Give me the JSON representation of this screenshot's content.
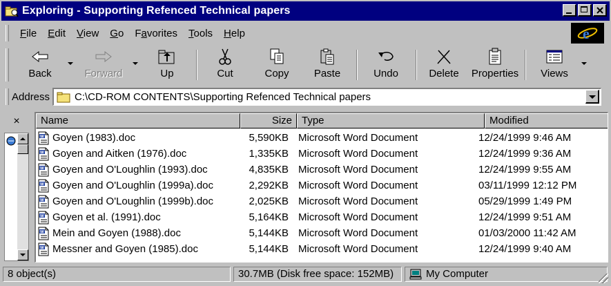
{
  "window": {
    "title": "Exploring - Supporting Refenced Technical papers",
    "app_icon": "explorer-folder-icon"
  },
  "menu": [
    {
      "label": "File",
      "underline": "F",
      "rest": "ile"
    },
    {
      "label": "Edit",
      "underline": "E",
      "rest": "dit"
    },
    {
      "label": "View",
      "underline": "V",
      "rest": "iew"
    },
    {
      "label": "Go",
      "underline": "G",
      "rest": "o"
    },
    {
      "label": "Favorites",
      "pre": "F",
      "underline": "a",
      "rest": "vorites"
    },
    {
      "label": "Tools",
      "underline": "T",
      "rest": "ools"
    },
    {
      "label": "Help",
      "underline": "H",
      "rest": "elp"
    }
  ],
  "toolbar": {
    "back": "Back",
    "forward": "Forward",
    "up": "Up",
    "cut": "Cut",
    "copy": "Copy",
    "paste": "Paste",
    "undo": "Undo",
    "delete": "Delete",
    "properties": "Properties",
    "views": "Views"
  },
  "address": {
    "label": "Address",
    "value": "C:\\CD-ROM CONTENTS\\Supporting Refenced Technical papers"
  },
  "tree": {
    "close_label": "×"
  },
  "columns": {
    "name": "Name",
    "size": "Size",
    "type": "Type",
    "modified": "Modified"
  },
  "files": [
    {
      "name": "Goyen (1983).doc",
      "size": "5,590KB",
      "type": "Microsoft Word Document",
      "modified": "12/24/1999 9:46 AM"
    },
    {
      "name": "Goyen and Aitken (1976).doc",
      "size": "1,335KB",
      "type": "Microsoft Word Document",
      "modified": "12/24/1999 9:36 AM"
    },
    {
      "name": "Goyen and O'Loughlin (1993).doc",
      "size": "4,835KB",
      "type": "Microsoft Word Document",
      "modified": "12/24/1999 9:55 AM"
    },
    {
      "name": "Goyen and O'Loughlin (1999a).doc",
      "size": "2,292KB",
      "type": "Microsoft Word Document",
      "modified": "03/11/1999 12:12 PM"
    },
    {
      "name": "Goyen and O'Loughlin (1999b).doc",
      "size": "2,025KB",
      "type": "Microsoft Word Document",
      "modified": "05/29/1999 1:49 PM"
    },
    {
      "name": "Goyen et al. (1991).doc",
      "size": "5,164KB",
      "type": "Microsoft Word Document",
      "modified": "12/24/1999 9:51 AM"
    },
    {
      "name": "Mein and Goyen (1988).doc",
      "size": "5,144KB",
      "type": "Microsoft Word Document",
      "modified": "01/03/2000 11:42 AM"
    },
    {
      "name": "Messner and Goyen (1985).doc",
      "size": "5,144KB",
      "type": "Microsoft Word Document",
      "modified": "12/24/1999 9:40 AM"
    }
  ],
  "status": {
    "objects": "8 object(s)",
    "disk": "30.7MB (Disk free space: 152MB)",
    "location": "My Computer"
  },
  "colors": {
    "titlebar": "#000080",
    "face": "#c0c0c0",
    "window_bg": "#ffffff"
  }
}
